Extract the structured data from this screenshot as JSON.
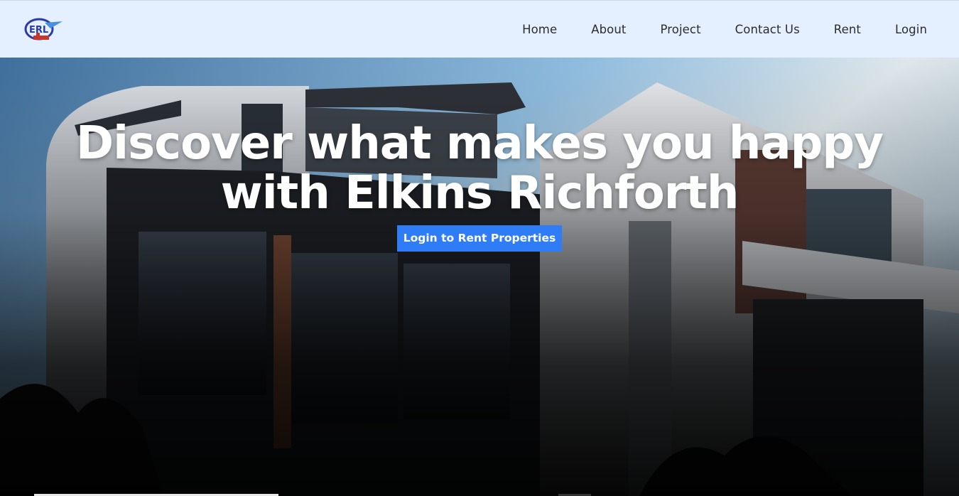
{
  "brand": {
    "logo_text": "ERL",
    "logo_colors": {
      "primary": "#2a3aa8",
      "accent": "#c0392b"
    }
  },
  "nav": {
    "links": [
      {
        "label": "Home"
      },
      {
        "label": "About"
      },
      {
        "label": "Project"
      },
      {
        "label": "Contact Us"
      },
      {
        "label": "Rent"
      },
      {
        "label": "Login"
      }
    ]
  },
  "hero": {
    "title_line1": "Discover what makes you happy",
    "title_line2": "with Elkins Richforth",
    "cta_label": "Login to Rent Properties",
    "cta_color": "#2f7df6",
    "background": "modern-apartment-building-photo"
  },
  "colors": {
    "navbar_bg": "#e4efff",
    "nav_text": "#2c2c2c"
  }
}
